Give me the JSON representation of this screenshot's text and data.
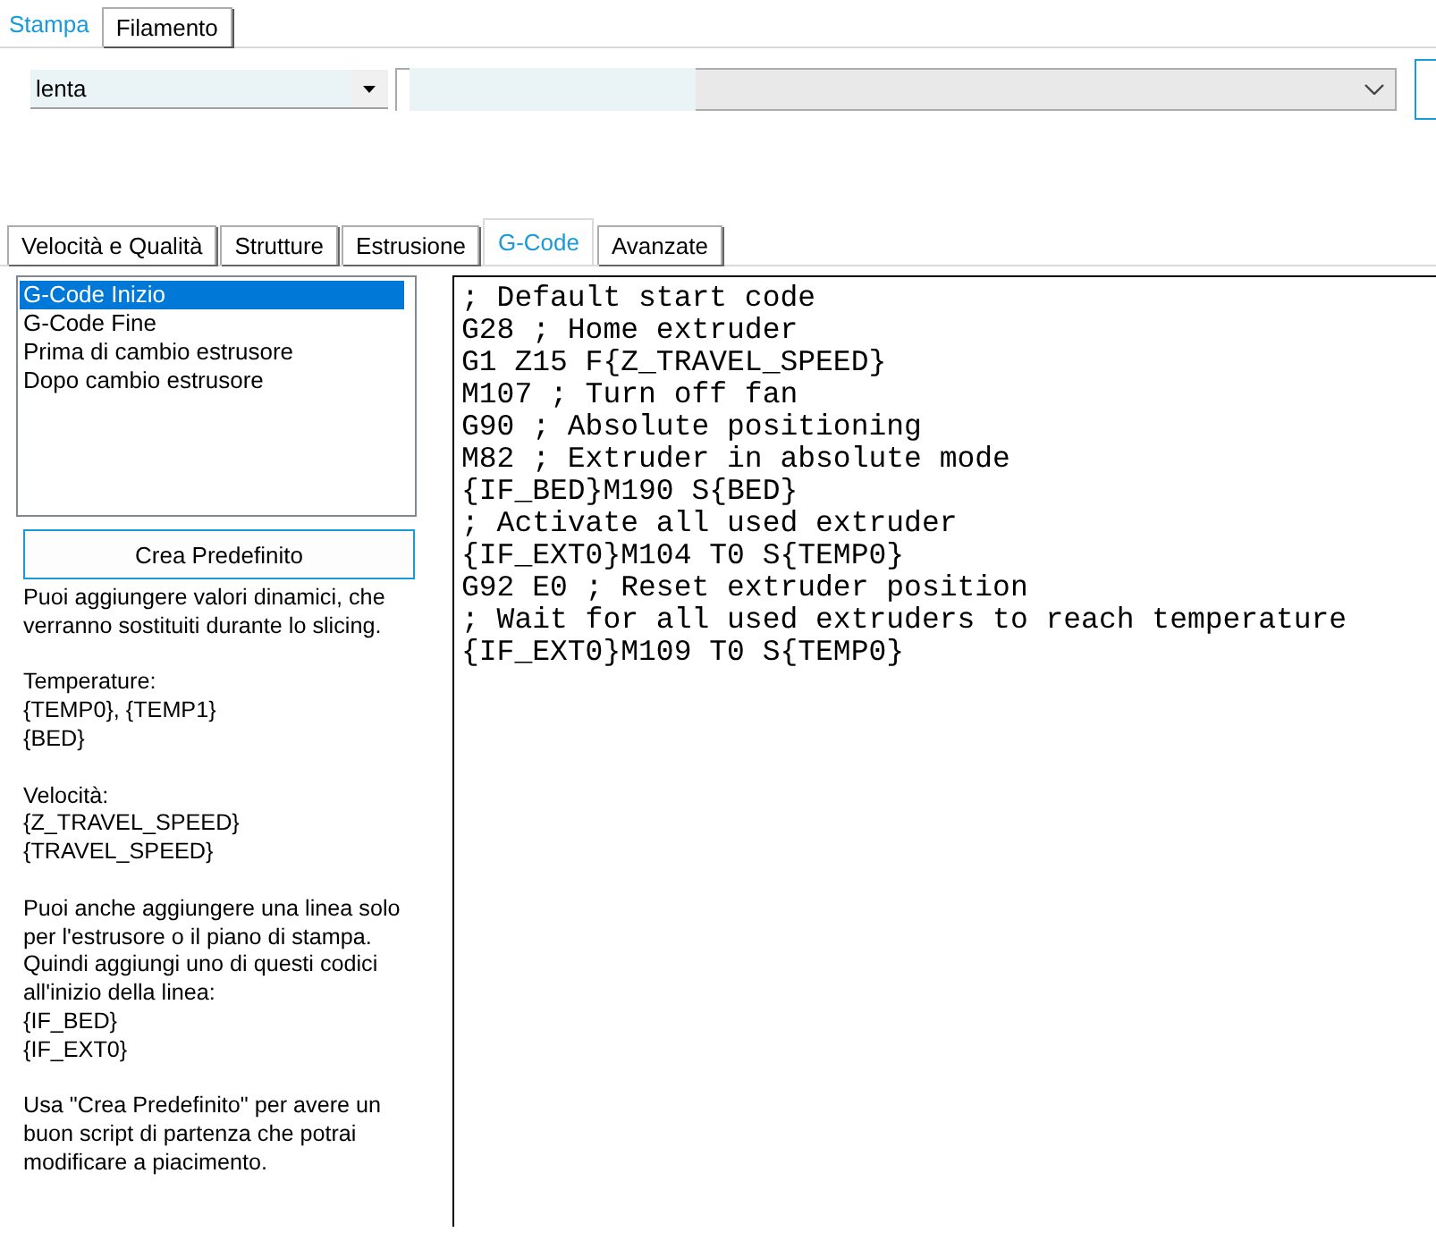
{
  "top_tabs": [
    {
      "label": "Stampa",
      "selected": true
    },
    {
      "label": "Filamento",
      "selected": false
    }
  ],
  "profile_combo": {
    "value": "lenta"
  },
  "section_tabs": [
    {
      "label": "Velocità e Qualità",
      "selected": false
    },
    {
      "label": "Strutture",
      "selected": false
    },
    {
      "label": "Estrusione",
      "selected": false
    },
    {
      "label": "G-Code",
      "selected": true
    },
    {
      "label": "Avanzate",
      "selected": false
    }
  ],
  "gcode_list": [
    {
      "label": "G-Code Inizio",
      "selected": true
    },
    {
      "label": "G-Code Fine",
      "selected": false
    },
    {
      "label": "Prima di cambio estrusore",
      "selected": false
    },
    {
      "label": "Dopo cambio estrusore",
      "selected": false
    }
  ],
  "default_button": "Crea Predefinito",
  "help": [
    "Puoi aggiungere valori dinamici, che verranno sostituiti durante lo slicing.",
    "Temperature:\n{TEMP0}, {TEMP1}\n{BED}",
    "Velocità:\n{Z_TRAVEL_SPEED}\n{TRAVEL_SPEED}",
    "Puoi anche aggiungere una linea solo per l'estrusore o il piano di stampa. Quindi aggiungi uno di questi codici all'inizio della linea:\n{IF_BED}\n{IF_EXT0}",
    "Usa \"Crea Predefinito\" per avere un buon script di partenza che potrai modificare a piacimento."
  ],
  "code": [
    "; Default start code",
    "G28 ; Home extruder",
    "G1 Z15 F{Z_TRAVEL_SPEED}",
    "M107 ; Turn off fan",
    "G90 ; Absolute positioning",
    "M82 ; Extruder in absolute mode",
    "{IF_BED}M190 S{BED}",
    "; Activate all used extruder",
    "{IF_EXT0}M104 T0 S{TEMP0}",
    "G92 E0 ; Reset extruder position",
    "; Wait for all used extruders to reach temperature",
    "{IF_EXT0}M109 T0 S{TEMP0}"
  ]
}
